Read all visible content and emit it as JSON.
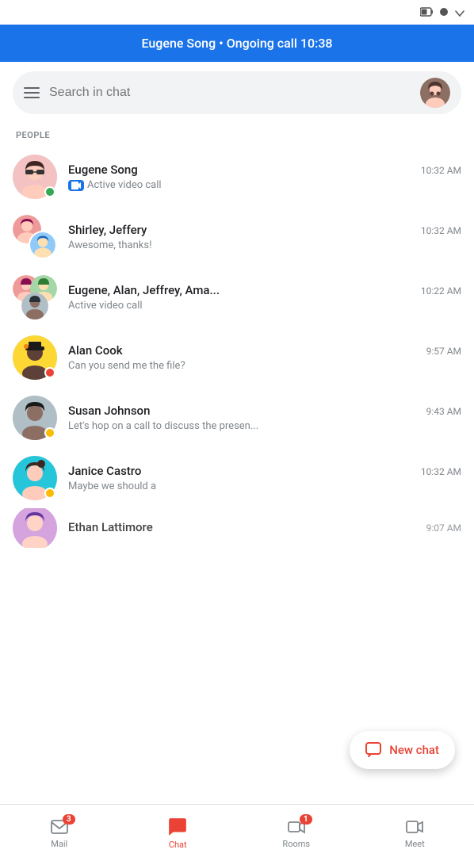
{
  "statusBar": {
    "icons": [
      "battery-icon",
      "circle-icon",
      "signal-icon"
    ]
  },
  "callBanner": {
    "text": "Eugene Song • Ongoing call 10:38"
  },
  "searchBar": {
    "placeholder": "Search in chat"
  },
  "sectionHeader": "PEOPLE",
  "chats": [
    {
      "id": "eugene-song",
      "name": "Eugene Song",
      "time": "10:32 AM",
      "preview": "Active video call",
      "hasVideoCall": true,
      "statusIndicator": "online",
      "avatarType": "single",
      "avatarColor": "#f4c2c2"
    },
    {
      "id": "shirley-jeffery",
      "name": "Shirley, Jeffery",
      "time": "10:32 AM",
      "preview": "Awesome, thanks!",
      "hasVideoCall": false,
      "statusIndicator": null,
      "avatarType": "group2",
      "avatarColor": "#c2d4f4"
    },
    {
      "id": "eugene-alan-group",
      "name": "Eugene, Alan, Jeffrey, Ama...",
      "time": "10:22 AM",
      "preview": "Active video call",
      "hasVideoCall": false,
      "statusIndicator": null,
      "avatarType": "group3",
      "avatarColor": "#c2f4d4"
    },
    {
      "id": "alan-cook",
      "name": "Alan Cook",
      "time": "9:57 AM",
      "preview": "Can you send me the file?",
      "hasVideoCall": false,
      "statusIndicator": "busy",
      "avatarType": "single",
      "avatarColor": "#fdd835"
    },
    {
      "id": "susan-johnson",
      "name": "Susan Johnson",
      "time": "9:43 AM",
      "preview": "Let's hop on a call to discuss the presen...",
      "hasVideoCall": false,
      "statusIndicator": "away",
      "avatarType": "single",
      "avatarColor": "#b0bec5"
    },
    {
      "id": "janice-castro",
      "name": "Janice Castro",
      "time": "10:32 AM",
      "preview": "Maybe we should a",
      "hasVideoCall": false,
      "statusIndicator": "away",
      "avatarType": "single",
      "avatarColor": "#26c6da"
    },
    {
      "id": "ethan-lattimore",
      "name": "Ethan Lattimore",
      "time": "9:07 AM",
      "preview": "",
      "hasVideoCall": false,
      "statusIndicator": null,
      "avatarType": "single",
      "avatarColor": "#ce93d8"
    }
  ],
  "fab": {
    "label": "New chat"
  },
  "bottomNav": [
    {
      "id": "mail",
      "label": "Mail",
      "badge": "3",
      "active": false
    },
    {
      "id": "chat",
      "label": "Chat",
      "badge": null,
      "active": true
    },
    {
      "id": "rooms",
      "label": "Rooms",
      "badge": "1",
      "active": false
    },
    {
      "id": "meet",
      "label": "Meet",
      "badge": null,
      "active": false
    }
  ]
}
